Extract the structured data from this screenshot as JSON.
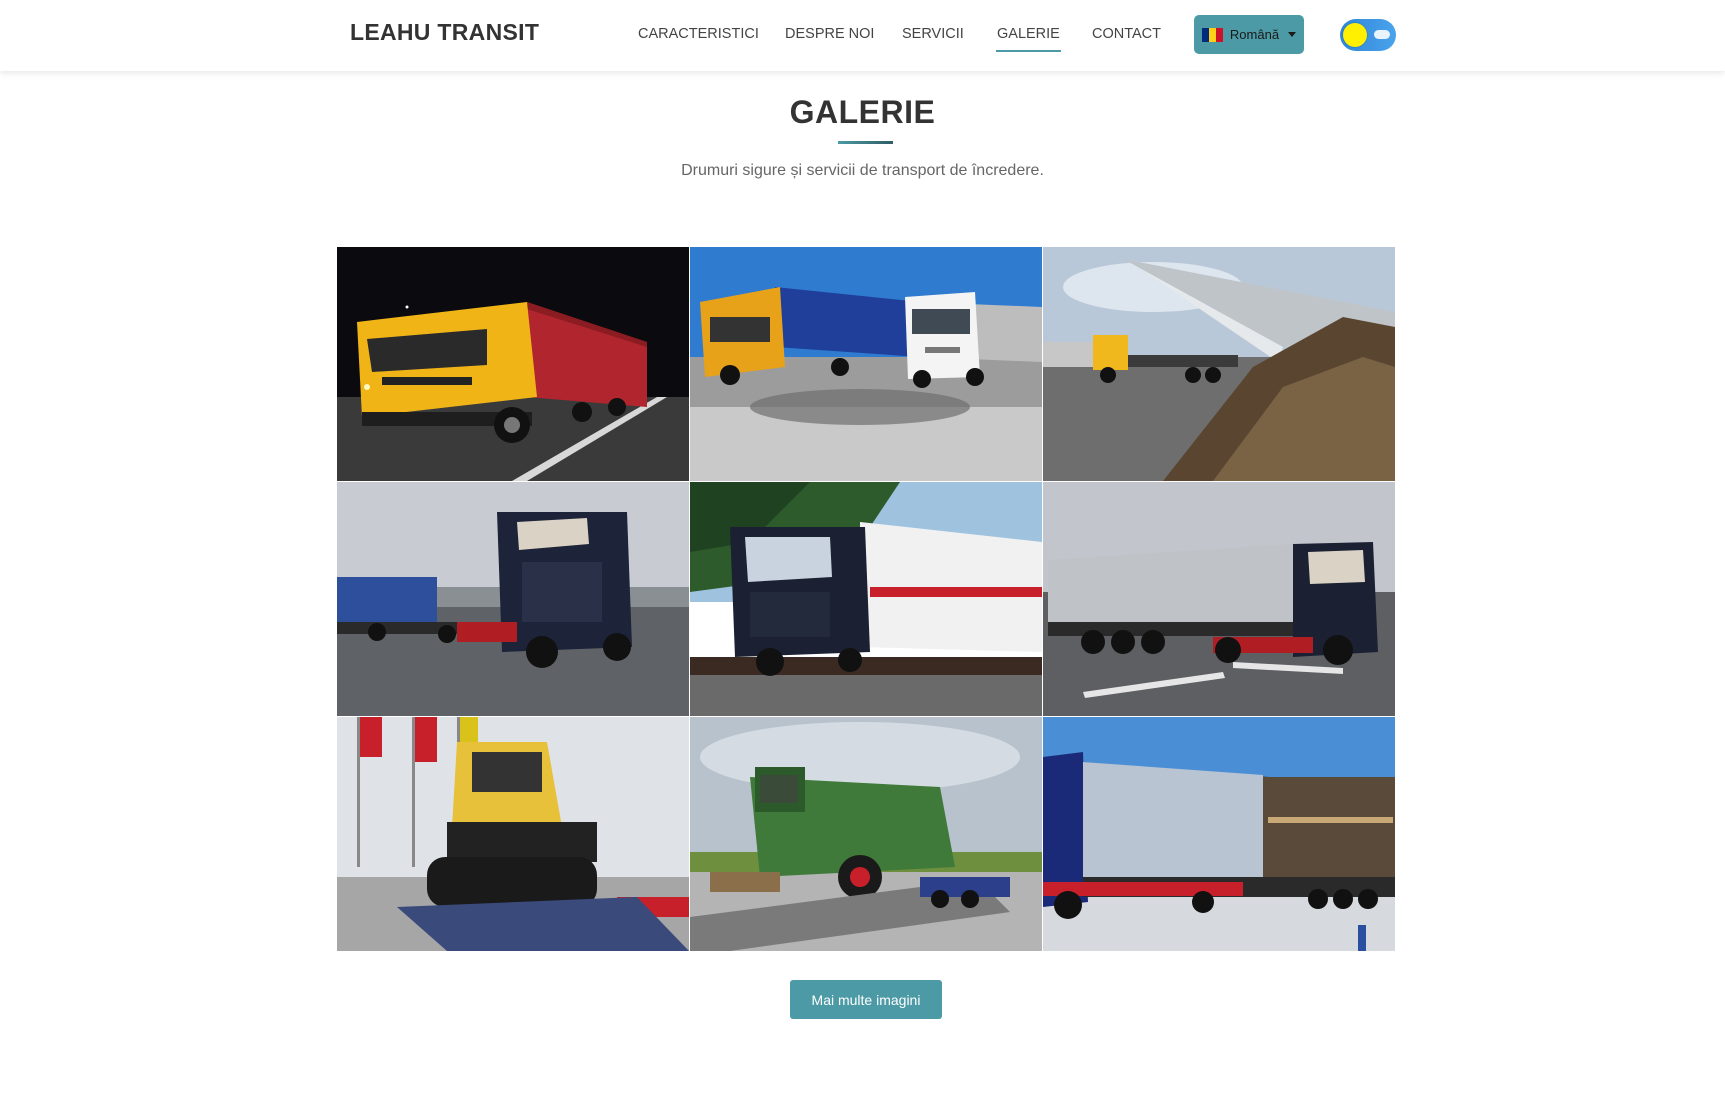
{
  "brand": "LEAHU TRANSIT",
  "nav": {
    "items": [
      "CARACTERISTICI",
      "DESPRE NOI",
      "SERVICII",
      "GALERIE",
      "CONTACT"
    ],
    "active": "GALERIE",
    "language_label": "Română",
    "language_flag_colors": [
      "#002B7F",
      "#FCD116",
      "#CE1126"
    ],
    "theme_toggle_icon": "sun-icon"
  },
  "gallery_section": {
    "title": "GALERIE",
    "subtitle": "Drumuri sigure și servicii de transport de încredere.",
    "more_button": "Mai multe imagini",
    "images": [
      {
        "name": "photo-yellow-iveco-truck-night"
      },
      {
        "name": "photo-yellow-and-white-trucks-parking"
      },
      {
        "name": "photo-tipper-unloading-sugar-beets"
      },
      {
        "name": "photo-dark-mercedes-lowbed-trailer"
      },
      {
        "name": "photo-mercedes-on-rail-wagon"
      },
      {
        "name": "photo-dark-truck-curtain-trailer"
      },
      {
        "name": "photo-yellow-tracked-tractor-on-trailer"
      },
      {
        "name": "photo-green-combine-harvester-on-trailer"
      },
      {
        "name": "photo-blue-truck-open-curtain-trailer"
      }
    ]
  },
  "colors": {
    "accent": "#4b9aa5",
    "text": "#333333",
    "subtitle": "#666666"
  }
}
